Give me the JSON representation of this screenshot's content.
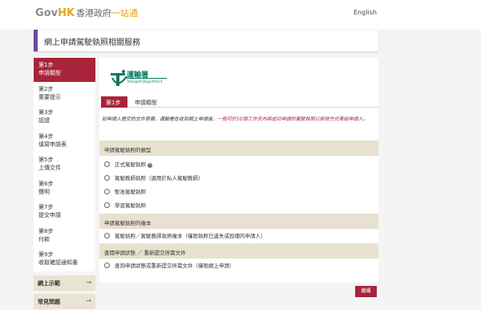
{
  "header": {
    "logo_gov": "Gov",
    "logo_hk": "HK",
    "logo_zh": "香港政府",
    "logo_zh2": "一站通",
    "language_link": "English"
  },
  "service_title": "網上申請駕駛執照相關服務",
  "sidebar": {
    "steps": [
      {
        "num": "第1步",
        "label": "申請類型",
        "active": true
      },
      {
        "num": "第2步",
        "label": "重要提示"
      },
      {
        "num": "第3步",
        "label": "認證"
      },
      {
        "num": "第4步",
        "label": "填寫申請表"
      },
      {
        "num": "第5步",
        "label": "上傳文件"
      },
      {
        "num": "第6步",
        "label": "聲明"
      },
      {
        "num": "第7步",
        "label": "提交申請"
      },
      {
        "num": "第8步",
        "label": "付款"
      },
      {
        "num": "第9步",
        "label": "收取確認通知書"
      }
    ],
    "links": [
      {
        "label": "網上示範",
        "arrow": "→"
      },
      {
        "label": "常見問題",
        "arrow": "→"
      }
    ]
  },
  "dept": {
    "name_zh": "運輸署",
    "name_en": "Transport Department"
  },
  "step_header": {
    "badge": "第1步",
    "title": "申請類型"
  },
  "notice": {
    "text": "如申請人提交的文件齊備，運輸署在收到網上申請後，",
    "highlight": "一般可於10個工作天內將成功申請的駕駛執照以掛號方式寄給申請人。"
  },
  "sections": [
    {
      "title": "申請駕駛執照的類型",
      "options": [
        "正式駕駛執照",
        "駕駛教師執照（適用於私人駕駛教師）",
        "暫准駕駛執照",
        "學習駕駛執照"
      ]
    },
    {
      "title": "申請駕駛執照的複本",
      "options": [
        "駕駛執照／駕駛教師執照複本（僅限執照已遺失或毀壞的申請人）"
      ]
    },
    {
      "title": "查閱申請狀態 ／ 重新提交所需文件",
      "options": [
        "查詢申請狀態或重新提交所需文件（僅限網上申請）"
      ]
    }
  ],
  "next_button": "繼續",
  "colors": {
    "accent": "#a8243a",
    "purple_bar": "#6d4a9c",
    "section_bg": "#e8e1cf",
    "dept_green": "#0a7b61"
  }
}
